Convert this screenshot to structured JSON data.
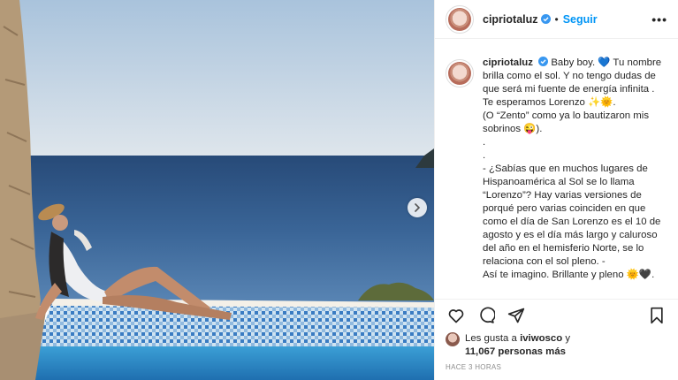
{
  "post": {
    "username": "cipriotaluz",
    "follow_label": "Seguir",
    "more_label": "•••",
    "time_ago": "HACE 3 HORAS"
  },
  "caption": {
    "username": "cipriotaluz",
    "line1": "Baby boy. 💙 Tu nombre brilla como el sol. Y no tengo dudas de que será mi fuente de energía infinita . Te esperamos Lorenzo ✨🌞.",
    "line2": "(O “Zento” como ya lo bautizaron mis sobrinos 😜).",
    "dot1": ".",
    "dot2": ".",
    "line3": "- ¿Sabías que en muchos lugares de Hispanoamérica al Sol se lo llama “Lorenzo”? Hay varias versiones de porqué pero varias coinciden en que como el día de San Lorenzo es el 10 de agosto y es el día más largo y caluroso del año en el hemisferio Norte, se lo relaciona con el sol pleno. -",
    "line4": "Así te imagino. Brillante y pleno 🌞🖤."
  },
  "likes": {
    "prefix": "Les gusta a ",
    "user": "iviwosco",
    "connector": " y",
    "count": "11,067 personas más"
  },
  "icons": {
    "verified": "verified-badge-icon",
    "like": "heart-icon",
    "comment": "comment-icon",
    "share": "share-icon",
    "save": "bookmark-icon",
    "next": "chevron-right-icon"
  },
  "colors": {
    "accent": "#0095f6",
    "text": "#262626",
    "muted": "#8e8e8e"
  }
}
